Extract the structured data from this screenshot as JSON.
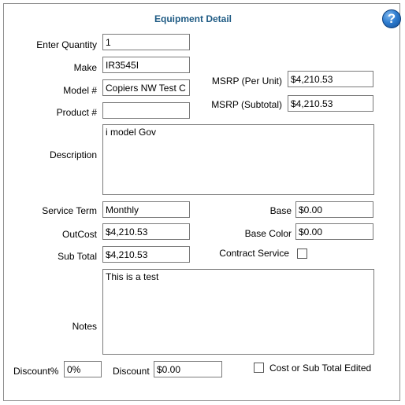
{
  "title": "Equipment Detail",
  "help_label": "?",
  "fields": {
    "enter_quantity": {
      "label": "Enter Quantity",
      "value": "1"
    },
    "make": {
      "label": "Make",
      "value": "IR3545I"
    },
    "model": {
      "label": "Model #",
      "value": "Copiers NW Test C"
    },
    "product": {
      "label": "Product #",
      "value": ""
    },
    "msrp_per_unit": {
      "label": "MSRP (Per Unit)",
      "value": "$4,210.53"
    },
    "msrp_subtotal": {
      "label": "MSRP (Subtotal)",
      "value": "$4,210.53"
    },
    "description": {
      "label": "Description",
      "value": "i model Gov"
    },
    "service_term": {
      "label": "Service Term",
      "value": "Monthly"
    },
    "outcost": {
      "label": "OutCost",
      "value": "$4,210.53"
    },
    "sub_total": {
      "label": "Sub Total",
      "value": "$4,210.53"
    },
    "base": {
      "label": "Base",
      "value": "$0.00"
    },
    "base_color": {
      "label": "Base Color",
      "value": "$0.00"
    },
    "contract_service": {
      "label": "Contract Service",
      "checked": false
    },
    "notes": {
      "label": "Notes",
      "value": "This is a test"
    },
    "discount_pct": {
      "label": "Discount%",
      "value": "0%"
    },
    "discount": {
      "label": "Discount",
      "value": "$0.00"
    },
    "cost_edited": {
      "label": "Cost or Sub Total Edited",
      "checked": false
    }
  }
}
